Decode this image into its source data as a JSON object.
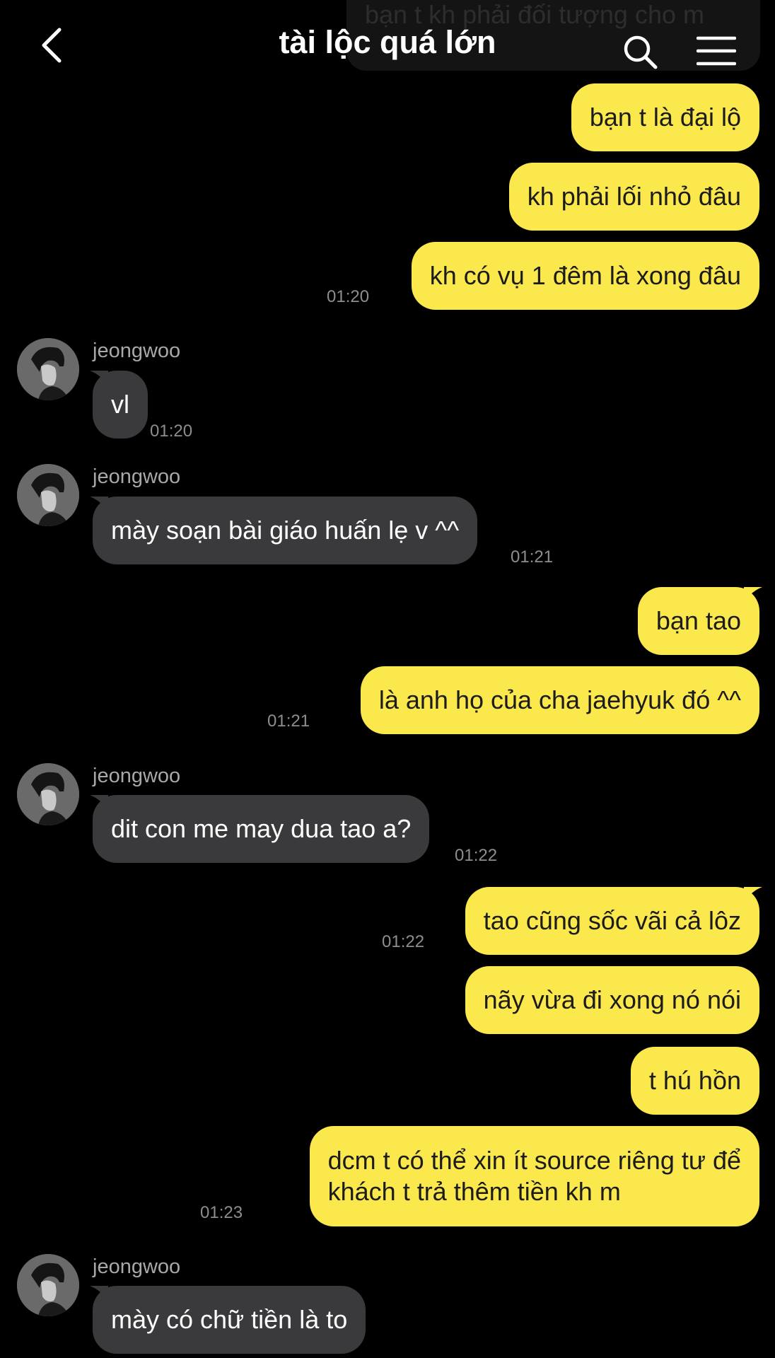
{
  "header": {
    "title": "tài lộc quá lớn",
    "back_icon": "chevron-left-icon",
    "search_icon": "search-icon",
    "menu_icon": "hamburger-menu-icon"
  },
  "colors": {
    "background": "#000000",
    "my_bubble": "#fbe84c",
    "their_bubble": "#3a3a3c",
    "timestamp": "#8d8d8d"
  },
  "partial_message": "bạn t kh phải đối tượng cho m",
  "sender_name": "jeongwoo",
  "messages": [
    {
      "from": "me",
      "text": "bạn t là đại lộ"
    },
    {
      "from": "me",
      "text": "kh phải lối nhỏ đâu"
    },
    {
      "from": "me",
      "text": "kh có vụ 1 đêm là xong đâu",
      "time": "01:20"
    },
    {
      "from": "them",
      "text": "vl",
      "time": "01:20"
    },
    {
      "from": "them",
      "text": "mày soạn bài giáo huấn lẹ v ^^",
      "time": "01:21"
    },
    {
      "from": "me",
      "text": "bạn tao"
    },
    {
      "from": "me",
      "text": "là anh họ của cha jaehyuk đó ^^",
      "time": "01:21"
    },
    {
      "from": "them",
      "text": "dit con me may dua tao a?",
      "time": "01:22"
    },
    {
      "from": "me",
      "text": "tao cũng sốc vãi cả lôz",
      "time": "01:22"
    },
    {
      "from": "me",
      "text": "nãy vừa đi xong nó nói"
    },
    {
      "from": "me",
      "text": "t hú hồn"
    },
    {
      "from": "me",
      "line1": "dcm t có thể xin ít source riêng tư để",
      "line2": "khách t trả thêm tiền kh m",
      "time": "01:23"
    },
    {
      "from": "them",
      "text": "mày có chữ tiền là to"
    }
  ]
}
